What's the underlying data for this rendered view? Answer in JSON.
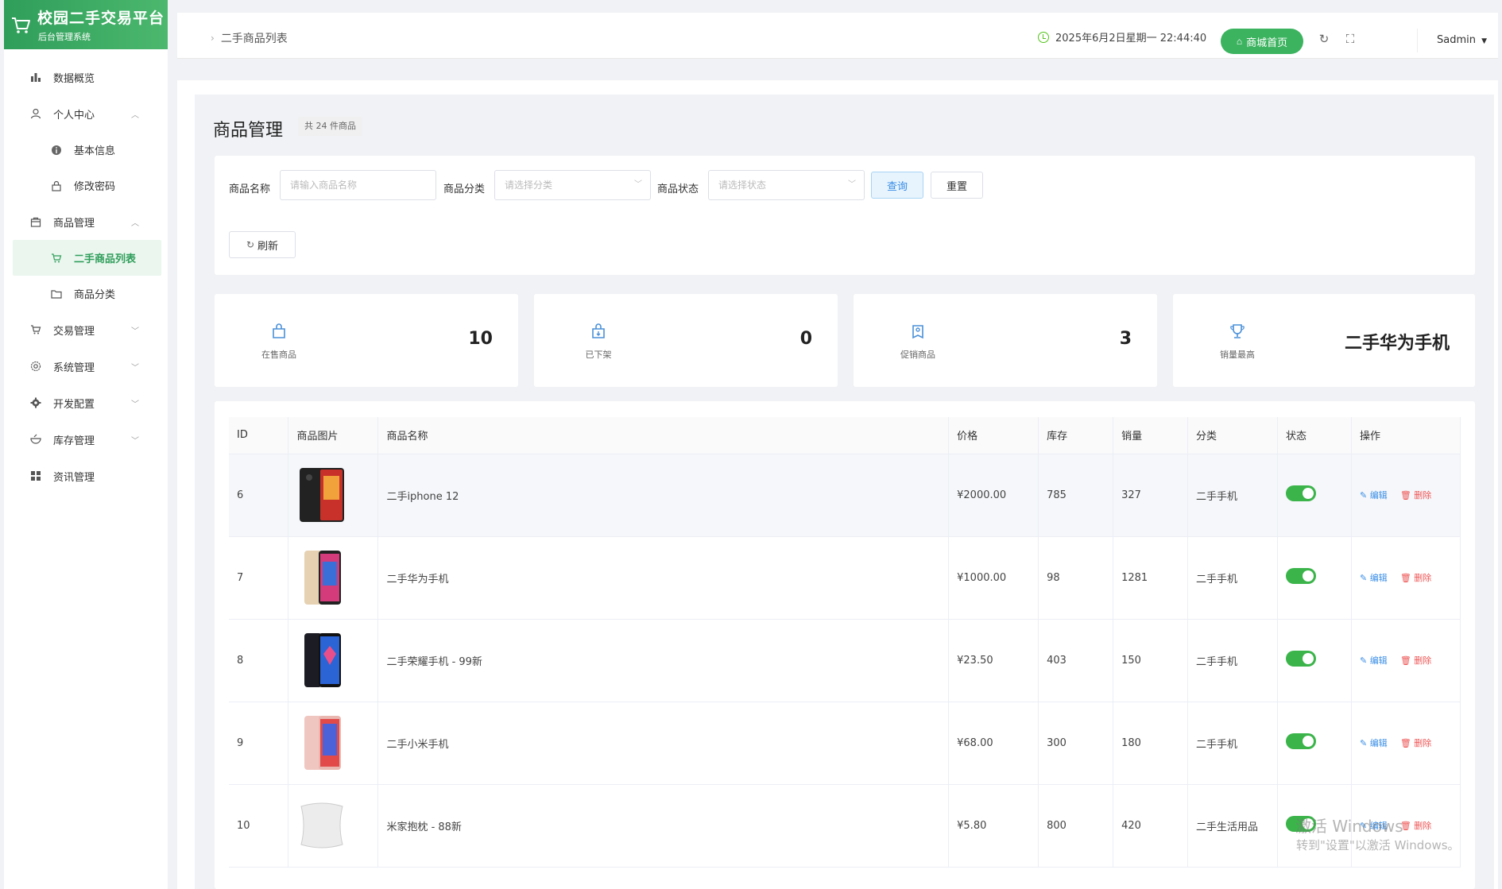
{
  "brand": {
    "title": "校园二手交易平台",
    "subtitle": "后台管理系统"
  },
  "sidebar": {
    "items": [
      {
        "label": "数据概览",
        "icon": "bar-chart-icon"
      },
      {
        "label": "个人中心",
        "icon": "user-icon",
        "expanded": true
      },
      {
        "label": "基本信息",
        "icon": "info-icon",
        "sub": true
      },
      {
        "label": "修改密码",
        "icon": "lock-icon",
        "sub": true
      },
      {
        "label": "商品管理",
        "icon": "bag-icon",
        "expanded": true
      },
      {
        "label": "二手商品列表",
        "icon": "cart-icon",
        "sub": true,
        "active": true
      },
      {
        "label": "商品分类",
        "icon": "folder-icon",
        "sub": true
      },
      {
        "label": "交易管理",
        "icon": "cart-icon"
      },
      {
        "label": "系统管理",
        "icon": "gear-icon"
      },
      {
        "label": "开发配置",
        "icon": "cog-icon"
      },
      {
        "label": "库存管理",
        "icon": "bowl-icon"
      },
      {
        "label": "资讯管理",
        "icon": "grid-icon"
      }
    ]
  },
  "header": {
    "breadcrumb": "二手商品列表",
    "datetime": "2025年6月2日星期一 22:44:40",
    "shop_button": "商城首页",
    "user": "Sadmin"
  },
  "page": {
    "title": "商品管理",
    "count_badge": "共 24 件商品"
  },
  "filter": {
    "name_label": "商品名称",
    "name_placeholder": "请输入商品名称",
    "category_label": "商品分类",
    "category_placeholder": "请选择分类",
    "status_label": "商品状态",
    "status_placeholder": "请选择状态",
    "query_button": "查询",
    "reset_button": "重置",
    "refresh_button": "刷新"
  },
  "stats": [
    {
      "label": "在售商品",
      "value": "10",
      "icon": "bag-icon"
    },
    {
      "label": "已下架",
      "value": "0",
      "icon": "bag-down-icon"
    },
    {
      "label": "促销商品",
      "value": "3",
      "icon": "tag-icon"
    },
    {
      "label": "销量最高",
      "value": "二手华为手机",
      "icon": "trophy-icon"
    }
  ],
  "table": {
    "columns": [
      "ID",
      "商品图片",
      "商品名称",
      "价格",
      "库存",
      "销量",
      "分类",
      "状态",
      "操作"
    ],
    "edit_label": "编辑",
    "delete_label": "删除",
    "rows": [
      {
        "id": "6",
        "name": "二手iphone 12",
        "price": "¥2000.00",
        "stock": "785",
        "sales": "327",
        "category": "二手手机",
        "status": true,
        "image": "phone-black"
      },
      {
        "id": "7",
        "name": "二手华为手机",
        "price": "¥1000.00",
        "stock": "98",
        "sales": "1281",
        "category": "二手手机",
        "status": true,
        "image": "phone-gold"
      },
      {
        "id": "8",
        "name": "二手荣耀手机 - 99新",
        "price": "¥23.50",
        "stock": "403",
        "sales": "150",
        "category": "二手手机",
        "status": true,
        "image": "phone-dark"
      },
      {
        "id": "9",
        "name": "二手小米手机",
        "price": "¥68.00",
        "stock": "300",
        "sales": "180",
        "category": "二手手机",
        "status": true,
        "image": "phone-pink"
      },
      {
        "id": "10",
        "name": "米家抱枕 - 88新",
        "price": "¥5.80",
        "stock": "800",
        "sales": "420",
        "category": "二手生活用品",
        "status": true,
        "image": "pillow"
      }
    ]
  },
  "watermark": {
    "line1": "激活 Windows",
    "line2": "转到\"设置\"以激活 Windows。"
  }
}
